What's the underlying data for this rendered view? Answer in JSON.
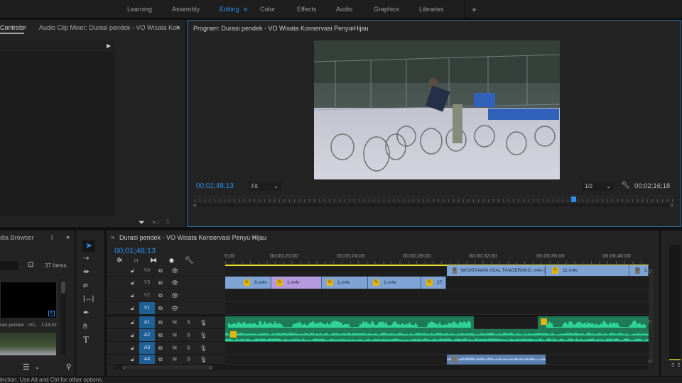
{
  "workspaces": {
    "items": [
      {
        "label": "Learning"
      },
      {
        "label": "Assembly"
      },
      {
        "label": "Editing",
        "active": true
      },
      {
        "label": "Color"
      },
      {
        "label": "Effects"
      },
      {
        "label": "Audio"
      },
      {
        "label": "Graphics"
      },
      {
        "label": "Libraries"
      }
    ],
    "more": "»",
    "menu_icon": "≡"
  },
  "left_panel": {
    "tab1": "Controls",
    "tab2": "Audio Clip Mixer: Durasi pendek - VO Wisata Kon",
    "more": "»"
  },
  "program": {
    "title": "Program: Durasi pendek - VO Wisata Konservasi Penyu Hijau",
    "timecode": "00;01;48;13",
    "fit": "Fit",
    "resolution": "1/2",
    "duration": "00;02;16;18",
    "playhead_fraction": 0.79
  },
  "project": {
    "tab": "dia Browser",
    "tab2": "l",
    "more": "»",
    "items_count": "37 Items",
    "item_label": "rasi pendek - VO...",
    "item_duration": "2;14;02"
  },
  "timeline": {
    "title": "Durasi pendek - VO Wisata Konservasi Penyu Hijau",
    "timecode": "00;01;48;13",
    "ruler": [
      "5;00",
      "00;00;20;00",
      "00;00;24;00",
      "00;00;28;00",
      "00;00;32;00",
      "00;00;36;00",
      "00;00;40;00"
    ],
    "video_tracks": [
      "V4",
      "V3",
      "V2",
      "V1"
    ],
    "audio_tracks": [
      "A1",
      "A2",
      "A3",
      "A4"
    ],
    "m": "M",
    "s": "S",
    "v4_clips": [
      "WISATAWAN ASAL TANGERANG .m4v [",
      "11.m4v",
      "3."
    ],
    "v3_clips": [
      "9.m4v",
      "1.m4v",
      "1.m4v",
      "1.m4v",
      "27."
    ],
    "fx": "fx"
  },
  "meter": {
    "s1": "S",
    "s2": "S"
  },
  "status": "lection. Use Alt and Ctrl for other options.",
  "colors": {
    "accent": "#2d8ceb",
    "video_clip": "#7ea3d4",
    "selected_clip": "#b59ae0",
    "audio_clip": "#1f7a57",
    "waveform": "#2fd39a",
    "playhead_line": "#e8e22a"
  }
}
